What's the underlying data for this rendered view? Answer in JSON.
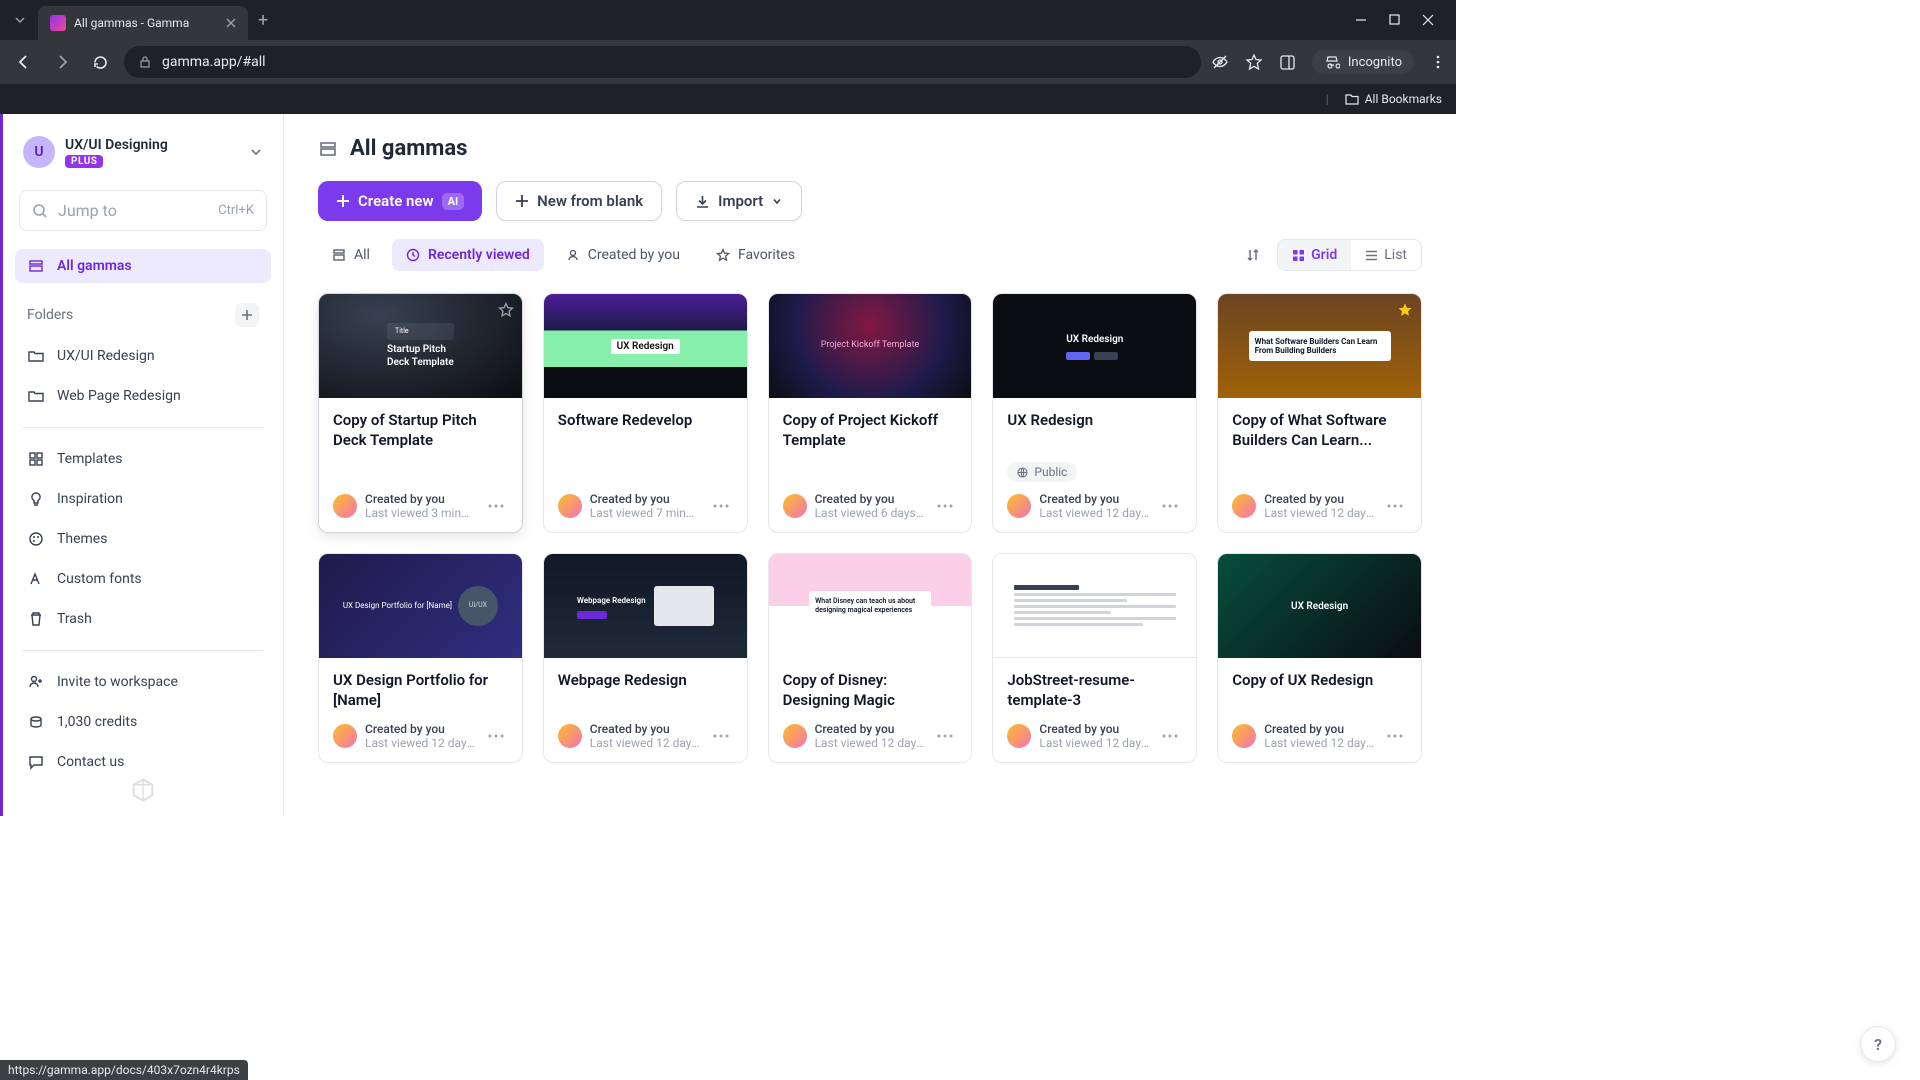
{
  "browser": {
    "tab_title": "All gammas - Gamma",
    "url": "gamma.app/#all",
    "incognito_label": "Incognito",
    "all_bookmarks": "All Bookmarks",
    "status_url": "https://gamma.app/docs/403x7ozn4r4krps"
  },
  "workspace": {
    "avatar_letter": "U",
    "name": "UX/UI Designing",
    "plan_badge": "PLUS"
  },
  "jump_to": {
    "placeholder": "Jump to",
    "shortcut": "Ctrl+K"
  },
  "sidebar": {
    "all_gammas": "All gammas",
    "folders_label": "Folders",
    "folders": [
      {
        "label": "UX/UI Redesign"
      },
      {
        "label": "Web Page Redesign"
      }
    ],
    "utility": [
      {
        "label": "Templates"
      },
      {
        "label": "Inspiration"
      },
      {
        "label": "Themes"
      },
      {
        "label": "Custom fonts"
      },
      {
        "label": "Trash"
      }
    ],
    "footer": [
      {
        "label": "Invite to workspace"
      },
      {
        "label": "1,030 credits"
      },
      {
        "label": "Contact us"
      }
    ]
  },
  "page": {
    "title": "All gammas",
    "create_new": "Create new",
    "ai_badge": "AI",
    "new_blank": "New from blank",
    "import": "Import"
  },
  "filters": {
    "all": "All",
    "recent": "Recently viewed",
    "created": "Created by you",
    "favorites": "Favorites",
    "grid": "Grid",
    "list": "List"
  },
  "labels": {
    "created_by_you": "Created by you",
    "public": "Public"
  },
  "cards": [
    {
      "title": "Copy of Startup Pitch Deck Template",
      "viewed": "Last viewed 3 minut...",
      "thumb_text": "Startup Pitch\nDeck Template"
    },
    {
      "title": "Software Redevelop",
      "viewed": "Last viewed 7 minute...",
      "thumb_text": "UX Redesign"
    },
    {
      "title": "Copy of Project Kickoff Template",
      "viewed": "Last viewed 6 days...",
      "thumb_text": "Project Kickoff Template"
    },
    {
      "title": "UX Redesign",
      "viewed": "Last viewed 12 days...",
      "thumb_text": "UX Redesign",
      "public": true
    },
    {
      "title": "Copy of What Software Builders Can Learn...",
      "viewed": "Last viewed 12 days...",
      "thumb_text": "What Software Builders Can Learn From Building Builders"
    },
    {
      "title": "UX Design Portfolio for [Name]",
      "viewed": "Last viewed 12 days...",
      "thumb_text": "UX Design Portfolio for [Name]"
    },
    {
      "title": "Webpage Redesign",
      "viewed": "Last viewed 12 days...",
      "thumb_text": "Webpage Redesign"
    },
    {
      "title": "Copy of Disney: Designing Magic",
      "viewed": "Last viewed 12 days...",
      "thumb_text": "What Disney can teach us about designing magical experiences"
    },
    {
      "title": "JobStreet-resume-template-3",
      "viewed": "Last viewed 12 days...",
      "thumb_text": ""
    },
    {
      "title": "Copy of UX Redesign",
      "viewed": "Last viewed 12 days...",
      "thumb_text": "UX Redesign"
    }
  ],
  "help": "?"
}
